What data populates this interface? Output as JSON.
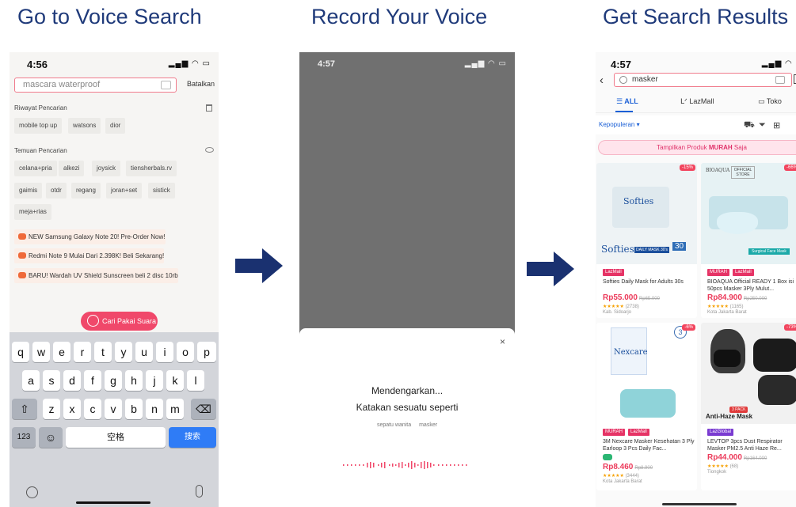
{
  "headings": {
    "step1": "Go to Voice Search",
    "step2": "Record Your Voice",
    "step3": "Get Search Results"
  },
  "colors": {
    "heading": "#1f3a7a",
    "arrow": "#1a3170",
    "accent": "#f0486a",
    "link": "#1a5fd6"
  },
  "panel1": {
    "status_time": "4:56",
    "status_icons": "signal-wifi-battery",
    "search_placeholder": "mascara waterproof",
    "cancel_label": "Batalkan",
    "history_title": "Riwayat Pencarian",
    "history_chips": [
      "mobile top up",
      "watsons",
      "dior"
    ],
    "discover_title": "Temuan Pencarian",
    "discover_chips": [
      "celana+pria",
      "alkezi",
      "joysick",
      "tiensherbals.rv",
      "gaimis",
      "otdr",
      "regang",
      "joran+set",
      "sistick",
      "meja+rias"
    ],
    "promos": [
      "NEW Samsung Galaxy Note 20! Pre-Order Now!",
      "Redmi Note 9 Mulai Dari 2.398K! Beli Sekarang!",
      "BARU! Wardah UV Shield Sunscreen beli 2 disc 10rb"
    ],
    "voice_button": "Cari Pakai Suara",
    "keyboard": {
      "row1": [
        "q",
        "w",
        "e",
        "r",
        "t",
        "y",
        "u",
        "i",
        "o",
        "p"
      ],
      "row2": [
        "a",
        "s",
        "d",
        "f",
        "g",
        "h",
        "j",
        "k",
        "l"
      ],
      "row3": [
        "z",
        "x",
        "c",
        "v",
        "b",
        "n",
        "m"
      ],
      "shift": "⇧",
      "backspace": "⌫",
      "num": "123",
      "emoji": "☺",
      "space": "空格",
      "search": "搜索"
    }
  },
  "panel2": {
    "status_time": "4:57",
    "close": "×",
    "listening": "Mendengarkan...",
    "say_prompt": "Katakan sesuatu seperti",
    "suggestions": [
      "sepatu wanita",
      "masker"
    ]
  },
  "panel3": {
    "status_time": "4:57",
    "search_value": "masker",
    "tabs": [
      "ALL",
      "LazMall",
      "Toko"
    ],
    "sort_label": "Kepopuleran ▾",
    "murah_banner_pre": "Tampilkan Produk",
    "murah_banner_bold": "MURAH",
    "murah_banner_post": "Saja",
    "products": [
      {
        "discount": "-15%",
        "tag": "LazMall",
        "tag2": "",
        "name": "Softies Daily Mask for Adults 30s",
        "price": "Rp55.000",
        "old_price": "Rp65.000",
        "rating_count": "(2738)",
        "location": "Kab. Sidoarjo",
        "brand": "Softies",
        "brand_caption": "DAILY MASK 30's",
        "brand_count": "30"
      },
      {
        "discount": "-66%",
        "tag": "MURAH",
        "tag2": "LazMall",
        "name": "BIOAQUA Official READY 1 Box isi 50pcs Masker 3Ply Mulut...",
        "price": "Rp84.900",
        "old_price": "Rp250.000",
        "rating_count": "(1165)",
        "location": "Kota Jakarta Barat",
        "brand": "BIOAQUA",
        "brand_caption": "OFFICIAL STORE",
        "ribbon": "Surgical Face Mask"
      },
      {
        "discount": "-6%",
        "tag": "MURAH",
        "tag2": "LazMall",
        "name": "3M Nexcare Masker Kesehatan 3 Ply Earloop 3 Pcs Daily Fac...",
        "price": "Rp8.460",
        "old_price": "Rp8.900",
        "rating_count": "(3444)",
        "location": "Kota Jakarta Barat",
        "brand": "Nexcare",
        "brand_badge": "3"
      },
      {
        "discount": "-73%",
        "tag": "LazGlobal",
        "tag2": "",
        "name": "LEVTOP 3pcs Dust Respirator Masker PM2.5 Anti Haze Re...",
        "price": "Rp44.000",
        "old_price": "Rp164.000",
        "rating_count": "(68)",
        "location": "Tiongkok",
        "brand": "Anti-Haze Mask",
        "badge": "3 PACK"
      }
    ]
  }
}
